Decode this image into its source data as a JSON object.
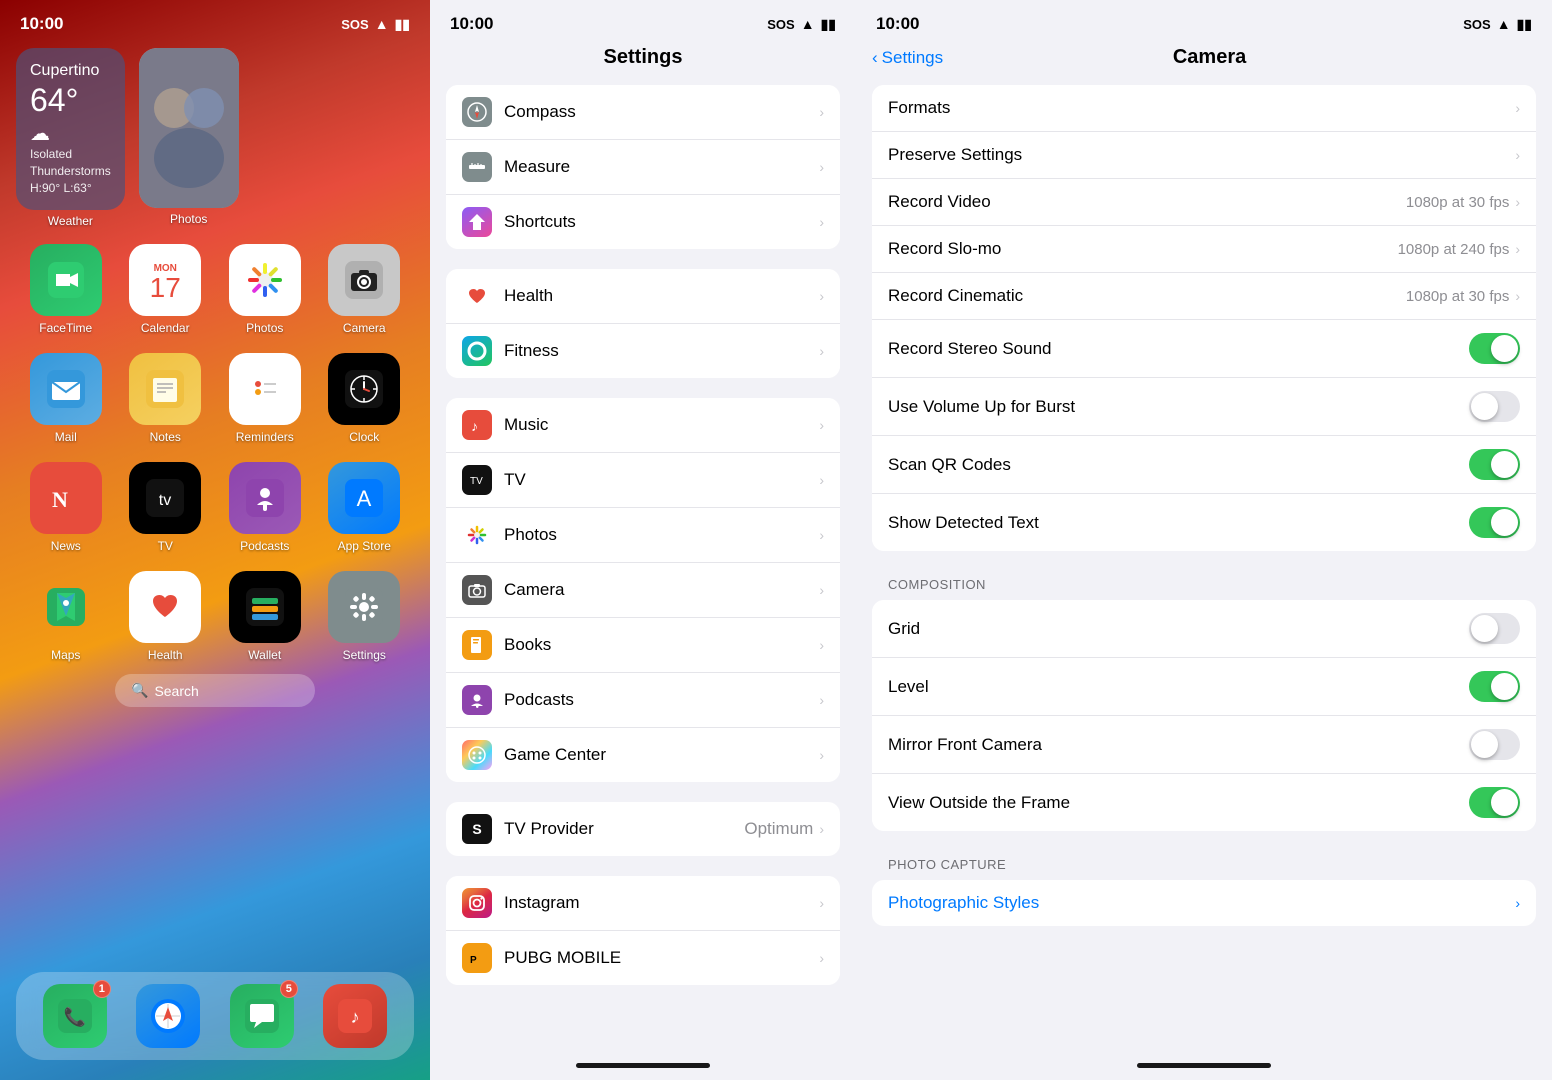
{
  "panel1": {
    "statusBar": {
      "time": "10:00",
      "sos": "SOS",
      "wifi": "wifi",
      "battery": "battery"
    },
    "weather": {
      "city": "Cupertino",
      "temp": "64°",
      "condition": "Isolated\nThunderstorms\nH:90° L:63°",
      "label": "Weather"
    },
    "photos": {
      "label": "Photos"
    },
    "apps": [
      {
        "id": "facetime",
        "label": "FaceTime",
        "icon": "📹"
      },
      {
        "id": "calendar",
        "label": "Calendar",
        "icon": "📅",
        "special": "calendar"
      },
      {
        "id": "photos",
        "label": "Photos",
        "icon": "🌸"
      },
      {
        "id": "camera",
        "label": "Camera",
        "icon": "📷"
      },
      {
        "id": "mail",
        "label": "Mail",
        "icon": "✉️"
      },
      {
        "id": "notes",
        "label": "Notes",
        "icon": "📝"
      },
      {
        "id": "reminders",
        "label": "Reminders",
        "icon": "🔴"
      },
      {
        "id": "clock",
        "label": "Clock",
        "icon": "🕐"
      },
      {
        "id": "news",
        "label": "News",
        "icon": "📰"
      },
      {
        "id": "appletv",
        "label": "TV",
        "icon": ""
      },
      {
        "id": "podcasts",
        "label": "Podcasts",
        "icon": "🎙"
      },
      {
        "id": "appstore",
        "label": "App Store",
        "icon": ""
      },
      {
        "id": "maps",
        "label": "Maps",
        "icon": "🗺"
      },
      {
        "id": "health",
        "label": "Health",
        "icon": "❤️"
      },
      {
        "id": "wallet",
        "label": "Wallet",
        "icon": "💳"
      },
      {
        "id": "settings",
        "label": "Settings",
        "icon": "⚙️"
      }
    ],
    "search": {
      "icon": "🔍",
      "label": "Search"
    },
    "dock": [
      {
        "id": "phone",
        "label": "Phone",
        "icon": "📞",
        "badge": "1"
      },
      {
        "id": "safari",
        "label": "Safari",
        "icon": "🧭",
        "badge": null
      },
      {
        "id": "messages",
        "label": "Messages",
        "icon": "💬",
        "badge": "5"
      },
      {
        "id": "music",
        "label": "Music",
        "icon": "🎵",
        "badge": null
      }
    ]
  },
  "panel2": {
    "statusBar": {
      "time": "10:00",
      "sos": "SOS"
    },
    "title": "Settings",
    "groups": [
      {
        "items": [
          {
            "id": "compass",
            "label": "Compass",
            "iconBg": "#7f8c8d",
            "iconEmoji": "🧭"
          },
          {
            "id": "measure",
            "label": "Measure",
            "iconBg": "#7f8c8d",
            "iconEmoji": "📏"
          },
          {
            "id": "shortcuts",
            "label": "Shortcuts",
            "iconBg": "linear-gradient(145deg,#8B5CF6,#EC4899)",
            "iconEmoji": "⚡"
          }
        ]
      },
      {
        "items": [
          {
            "id": "health",
            "label": "Health",
            "iconBg": "white",
            "iconEmoji": "❤️"
          },
          {
            "id": "fitness",
            "label": "Fitness",
            "iconBg": "linear-gradient(145deg,#0ea5e9,#22d3ee)",
            "iconEmoji": "🏃"
          }
        ]
      },
      {
        "items": [
          {
            "id": "music",
            "label": "Music",
            "iconBg": "#e74c3c",
            "iconEmoji": "🎵"
          },
          {
            "id": "tv",
            "label": "TV",
            "iconBg": "black",
            "iconEmoji": ""
          },
          {
            "id": "photos",
            "label": "Photos",
            "iconBg": "white",
            "iconEmoji": "🌸"
          },
          {
            "id": "camera",
            "label": "Camera",
            "iconBg": "#555",
            "iconEmoji": "📷"
          },
          {
            "id": "books",
            "label": "Books",
            "iconBg": "#f39c12",
            "iconEmoji": "📖"
          },
          {
            "id": "podcasts",
            "label": "Podcasts",
            "iconBg": "#8e44ad",
            "iconEmoji": "🎙"
          },
          {
            "id": "gamecenter",
            "label": "Game Center",
            "iconBg": "white",
            "iconEmoji": "🎮"
          }
        ]
      },
      {
        "items": [
          {
            "id": "tvprovider",
            "label": "TV Provider",
            "iconBg": "black",
            "iconEmoji": "S",
            "value": "Optimum"
          }
        ]
      },
      {
        "items": [
          {
            "id": "instagram",
            "label": "Instagram",
            "iconBg": "linear-gradient(145deg,#e91e63,#9c27b0)",
            "iconEmoji": "📸"
          },
          {
            "id": "pubg",
            "label": "PUBG MOBILE",
            "iconBg": "#f39c12",
            "iconEmoji": "🎮"
          }
        ]
      }
    ]
  },
  "panel3": {
    "statusBar": {
      "time": "10:00",
      "sos": "SOS"
    },
    "backLabel": "Settings",
    "title": "Camera",
    "groups": [
      {
        "items": [
          {
            "id": "formats",
            "label": "Formats",
            "type": "chevron"
          },
          {
            "id": "preserve-settings",
            "label": "Preserve Settings",
            "type": "chevron"
          },
          {
            "id": "record-video",
            "label": "Record Video",
            "value": "1080p at 30 fps",
            "type": "chevron-value"
          },
          {
            "id": "record-slomo",
            "label": "Record Slo-mo",
            "value": "1080p at 240 fps",
            "type": "chevron-value"
          },
          {
            "id": "record-cinematic",
            "label": "Record Cinematic",
            "value": "1080p at 30 fps",
            "type": "chevron-value"
          },
          {
            "id": "record-stereo",
            "label": "Record Stereo Sound",
            "type": "toggle",
            "on": true
          },
          {
            "id": "volume-burst",
            "label": "Use Volume Up for Burst",
            "type": "toggle",
            "on": false
          },
          {
            "id": "scan-qr",
            "label": "Scan QR Codes",
            "type": "toggle",
            "on": true
          },
          {
            "id": "show-detected-text",
            "label": "Show Detected Text",
            "type": "toggle",
            "on": true
          }
        ]
      },
      {
        "header": "COMPOSITION",
        "items": [
          {
            "id": "grid",
            "label": "Grid",
            "type": "toggle",
            "on": false
          },
          {
            "id": "level",
            "label": "Level",
            "type": "toggle",
            "on": true
          },
          {
            "id": "mirror-front",
            "label": "Mirror Front Camera",
            "type": "toggle",
            "on": false
          },
          {
            "id": "view-outside",
            "label": "View Outside the Frame",
            "type": "toggle",
            "on": true
          }
        ]
      },
      {
        "header": "PHOTO CAPTURE",
        "items": [
          {
            "id": "photographic-styles",
            "label": "Photographic Styles",
            "type": "chevron-blue"
          }
        ]
      }
    ]
  }
}
